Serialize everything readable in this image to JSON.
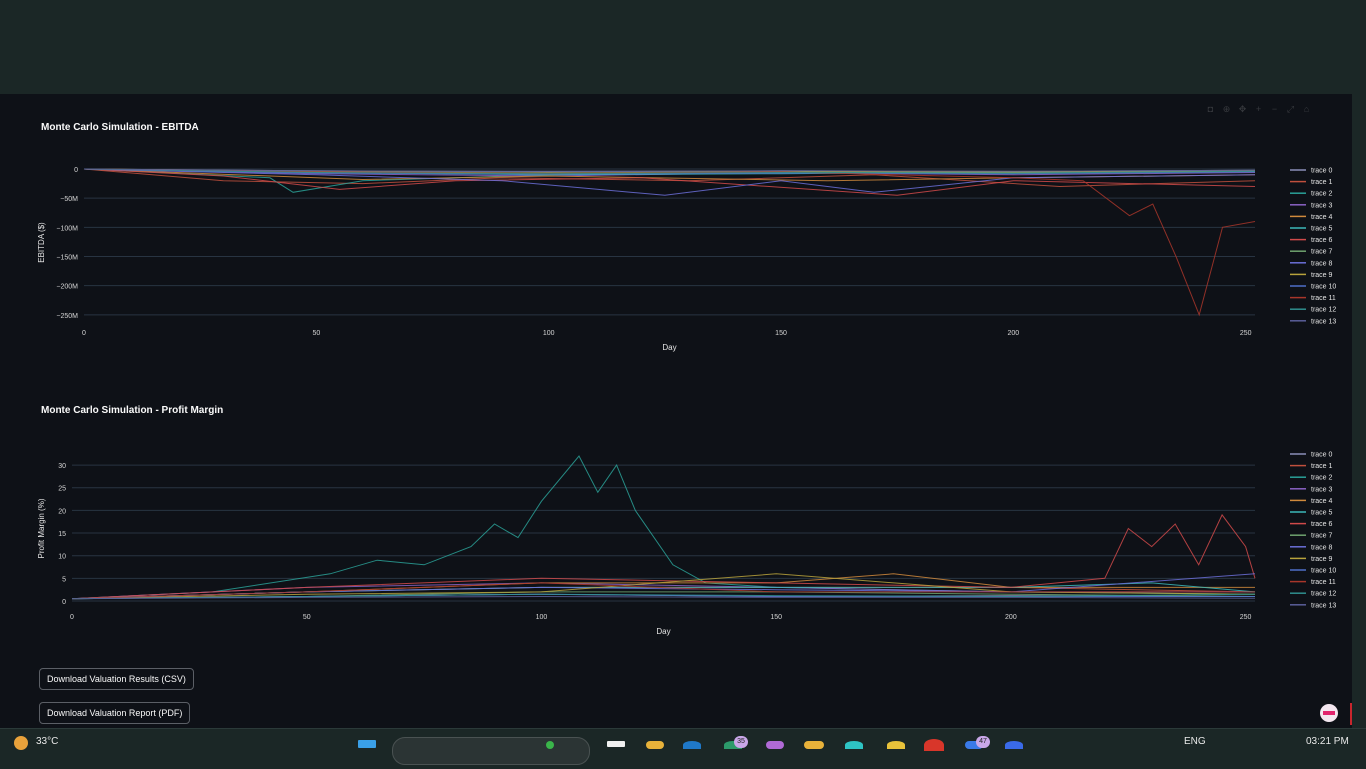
{
  "chart_data": [
    {
      "type": "line",
      "title": "Monte Carlo Simulation - EBITDA",
      "xlabel": "Day",
      "ylabel": "EBITDA ($)",
      "xlim": [
        0,
        252
      ],
      "ylim": [
        -252000000,
        0
      ],
      "xticks": [
        "0",
        "50",
        "100",
        "150",
        "200",
        "250"
      ],
      "yticks": [
        "0",
        "−50M",
        "−100M",
        "−150M",
        "−200M",
        "−250M"
      ],
      "ytick_values": [
        0,
        -50000000,
        -100000000,
        -150000000,
        -200000000,
        -250000000
      ],
      "legend_position": "right",
      "grid": true,
      "series": [
        {
          "name": "trace 0",
          "color": "#8a8fb8",
          "values": [
            [
              0,
              0
            ],
            [
              50,
              -3000000
            ],
            [
              100,
              -4000000
            ],
            [
              150,
              -3000000
            ],
            [
              200,
              -4000000
            ],
            [
              252,
              -2000000
            ]
          ]
        },
        {
          "name": "trace 1",
          "color": "#c0503d",
          "values": [
            [
              0,
              0
            ],
            [
              30,
              -20000000
            ],
            [
              60,
              -25000000
            ],
            [
              90,
              -15000000
            ],
            [
              130,
              -20000000
            ],
            [
              170,
              -10000000
            ],
            [
              210,
              -30000000
            ],
            [
              252,
              -20000000
            ]
          ]
        },
        {
          "name": "trace 2",
          "color": "#2aa198",
          "values": [
            [
              0,
              0
            ],
            [
              40,
              -15000000
            ],
            [
              45,
              -40000000
            ],
            [
              60,
              -20000000
            ],
            [
              100,
              -10000000
            ],
            [
              150,
              -5000000
            ],
            [
              200,
              -8000000
            ],
            [
              252,
              -5000000
            ]
          ]
        },
        {
          "name": "trace 3",
          "color": "#8a62c4",
          "values": [
            [
              0,
              0
            ],
            [
              50,
              -8000000
            ],
            [
              100,
              -12000000
            ],
            [
              150,
              -6000000
            ],
            [
              200,
              -10000000
            ],
            [
              252,
              -6000000
            ]
          ]
        },
        {
          "name": "trace 4",
          "color": "#d08a3c",
          "values": [
            [
              0,
              0
            ],
            [
              60,
              -18000000
            ],
            [
              100,
              -12000000
            ],
            [
              160,
              -20000000
            ],
            [
              200,
              -15000000
            ],
            [
              252,
              -10000000
            ]
          ]
        },
        {
          "name": "trace 5",
          "color": "#3bb8b8",
          "values": [
            [
              0,
              0
            ],
            [
              50,
              -6000000
            ],
            [
              100,
              -10000000
            ],
            [
              150,
              -8000000
            ],
            [
              200,
              -5000000
            ],
            [
              252,
              -4000000
            ]
          ]
        },
        {
          "name": "trace 6",
          "color": "#d04a4a",
          "values": [
            [
              0,
              0
            ],
            [
              30,
              -12000000
            ],
            [
              55,
              -35000000
            ],
            [
              80,
              -20000000
            ],
            [
              120,
              -15000000
            ],
            [
              175,
              -45000000
            ],
            [
              200,
              -20000000
            ],
            [
              252,
              -30000000
            ]
          ]
        },
        {
          "name": "trace 7",
          "color": "#6fa36f",
          "values": [
            [
              0,
              0
            ],
            [
              50,
              -5000000
            ],
            [
              100,
              -8000000
            ],
            [
              150,
              -5000000
            ],
            [
              200,
              -6000000
            ],
            [
              252,
              -4000000
            ]
          ]
        },
        {
          "name": "trace 8",
          "color": "#6b6fd8",
          "values": [
            [
              0,
              0
            ],
            [
              50,
              -10000000
            ],
            [
              90,
              -20000000
            ],
            [
              125,
              -45000000
            ],
            [
              150,
              -20000000
            ],
            [
              170,
              -40000000
            ],
            [
              200,
              -15000000
            ],
            [
              252,
              -10000000
            ]
          ]
        },
        {
          "name": "trace 9",
          "color": "#b8a33c",
          "values": [
            [
              0,
              0
            ],
            [
              50,
              -4000000
            ],
            [
              100,
              -6000000
            ],
            [
              150,
              -4000000
            ],
            [
              200,
              -5000000
            ],
            [
              252,
              -3000000
            ]
          ]
        },
        {
          "name": "trace 10",
          "color": "#4f6fc9",
          "values": [
            [
              0,
              0
            ],
            [
              50,
              -7000000
            ],
            [
              100,
              -9000000
            ],
            [
              150,
              -7000000
            ],
            [
              200,
              -8000000
            ],
            [
              252,
              -5000000
            ]
          ]
        },
        {
          "name": "trace 11",
          "color": "#a8362a",
          "values": [
            [
              0,
              0
            ],
            [
              50,
              -5000000
            ],
            [
              100,
              -8000000
            ],
            [
              150,
              -5000000
            ],
            [
              200,
              -15000000
            ],
            [
              215,
              -20000000
            ],
            [
              225,
              -80000000
            ],
            [
              230,
              -60000000
            ],
            [
              235,
              -150000000
            ],
            [
              240,
              -250000000
            ],
            [
              245,
              -100000000
            ],
            [
              252,
              -90000000
            ]
          ]
        },
        {
          "name": "trace 12",
          "color": "#2f8f8f",
          "values": [
            [
              0,
              0
            ],
            [
              50,
              -6000000
            ],
            [
              100,
              -8000000
            ],
            [
              150,
              -6000000
            ],
            [
              200,
              -7000000
            ],
            [
              252,
              -4000000
            ]
          ]
        },
        {
          "name": "trace 13",
          "color": "#5a5f9a",
          "values": [
            [
              0,
              0
            ],
            [
              50,
              -3000000
            ],
            [
              100,
              -5000000
            ],
            [
              150,
              -3000000
            ],
            [
              200,
              -4000000
            ],
            [
              252,
              -2000000
            ]
          ]
        }
      ]
    },
    {
      "type": "line",
      "title": "Monte Carlo Simulation - Profit Margin",
      "xlabel": "Day",
      "ylabel": "Profit Margin (%)",
      "xlim": [
        0,
        252
      ],
      "ylim": [
        0,
        32
      ],
      "xticks": [
        "0",
        "50",
        "100",
        "150",
        "200",
        "250"
      ],
      "yticks": [
        "0",
        "5",
        "10",
        "15",
        "20",
        "25",
        "30"
      ],
      "ytick_values": [
        0,
        5,
        10,
        15,
        20,
        25,
        30
      ],
      "legend_position": "right",
      "grid": true,
      "series": [
        {
          "name": "trace 0",
          "color": "#8a8fb8",
          "values": [
            [
              0,
              0.5
            ],
            [
              50,
              1
            ],
            [
              100,
              1.5
            ],
            [
              150,
              1
            ],
            [
              200,
              1.2
            ],
            [
              252,
              1
            ]
          ]
        },
        {
          "name": "trace 1",
          "color": "#c0503d",
          "values": [
            [
              0,
              0.5
            ],
            [
              50,
              2
            ],
            [
              100,
              3
            ],
            [
              150,
              3
            ],
            [
              200,
              3
            ],
            [
              252,
              2
            ]
          ]
        },
        {
          "name": "trace 2",
          "color": "#2aa198",
          "values": [
            [
              0,
              0.5
            ],
            [
              30,
              2
            ],
            [
              55,
              6
            ],
            [
              65,
              9
            ],
            [
              75,
              8
            ],
            [
              85,
              12
            ],
            [
              90,
              17
            ],
            [
              95,
              14
            ],
            [
              100,
              22
            ],
            [
              108,
              32
            ],
            [
              112,
              24
            ],
            [
              116,
              30
            ],
            [
              120,
              20
            ],
            [
              128,
              8
            ],
            [
              135,
              4
            ],
            [
              150,
              3
            ],
            [
              200,
              2
            ],
            [
              252,
              1.5
            ]
          ]
        },
        {
          "name": "trace 3",
          "color": "#8a62c4",
          "values": [
            [
              0,
              0.5
            ],
            [
              50,
              3
            ],
            [
              100,
              4
            ],
            [
              150,
              3
            ],
            [
              200,
              2
            ],
            [
              252,
              2
            ]
          ]
        },
        {
          "name": "trace 4",
          "color": "#d08a3c",
          "values": [
            [
              0,
              0.5
            ],
            [
              50,
              2
            ],
            [
              100,
              4
            ],
            [
              150,
              4
            ],
            [
              175,
              6
            ],
            [
              200,
              3
            ],
            [
              252,
              3
            ]
          ]
        },
        {
          "name": "trace 5",
          "color": "#3bb8b8",
          "values": [
            [
              0,
              0.5
            ],
            [
              50,
              2
            ],
            [
              100,
              3
            ],
            [
              150,
              3
            ],
            [
              200,
              3
            ],
            [
              230,
              4
            ],
            [
              252,
              2
            ]
          ]
        },
        {
          "name": "trace 6",
          "color": "#d04a4a",
          "values": [
            [
              0,
              0.5
            ],
            [
              50,
              3
            ],
            [
              100,
              5
            ],
            [
              150,
              4
            ],
            [
              200,
              3
            ],
            [
              220,
              5
            ],
            [
              225,
              16
            ],
            [
              230,
              12
            ],
            [
              235,
              17
            ],
            [
              240,
              8
            ],
            [
              245,
              19
            ],
            [
              250,
              12
            ],
            [
              252,
              5
            ]
          ]
        },
        {
          "name": "trace 7",
          "color": "#6fa36f",
          "values": [
            [
              0,
              0.5
            ],
            [
              50,
              1
            ],
            [
              100,
              2
            ],
            [
              150,
              2
            ],
            [
              200,
              1.5
            ],
            [
              252,
              1
            ]
          ]
        },
        {
          "name": "trace 8",
          "color": "#6b6fd8",
          "values": [
            [
              0,
              0.5
            ],
            [
              50,
              2
            ],
            [
              100,
              3
            ],
            [
              150,
              2.5
            ],
            [
              200,
              2
            ],
            [
              252,
              6
            ]
          ]
        },
        {
          "name": "trace 9",
          "color": "#b8a33c",
          "values": [
            [
              0,
              0.5
            ],
            [
              50,
              1.5
            ],
            [
              100,
              2
            ],
            [
              150,
              6
            ],
            [
              200,
              2
            ],
            [
              252,
              1.5
            ]
          ]
        },
        {
          "name": "trace 10",
          "color": "#4f6fc9",
          "values": [
            [
              0,
              0.5
            ],
            [
              50,
              1
            ],
            [
              100,
              1.5
            ],
            [
              150,
              1
            ],
            [
              200,
              1
            ],
            [
              252,
              1
            ]
          ]
        },
        {
          "name": "trace 11",
          "color": "#a8362a",
          "values": [
            [
              0,
              0.5
            ],
            [
              50,
              2
            ],
            [
              100,
              4
            ],
            [
              150,
              2
            ],
            [
              200,
              2
            ],
            [
              252,
              2
            ]
          ]
        },
        {
          "name": "trace 12",
          "color": "#2f8f8f",
          "values": [
            [
              0,
              0.5
            ],
            [
              50,
              1
            ],
            [
              100,
              1.5
            ],
            [
              150,
              1.2
            ],
            [
              200,
              1
            ],
            [
              252,
              1.5
            ]
          ]
        },
        {
          "name": "trace 13",
          "color": "#5a5f9a",
          "values": [
            [
              0,
              0.5
            ],
            [
              50,
              0.8
            ],
            [
              100,
              1
            ],
            [
              150,
              0.8
            ],
            [
              200,
              0.8
            ],
            [
              252,
              0.6
            ]
          ]
        }
      ]
    }
  ],
  "buttons": {
    "csv_label": "Download Valuation Results (CSV)",
    "pdf_label": "Download Valuation Report (PDF)"
  },
  "taskbar": {
    "weather": "33°C",
    "language": "ENG",
    "time": "03:21 PM",
    "badge_1": "35",
    "badge_2": "47"
  }
}
